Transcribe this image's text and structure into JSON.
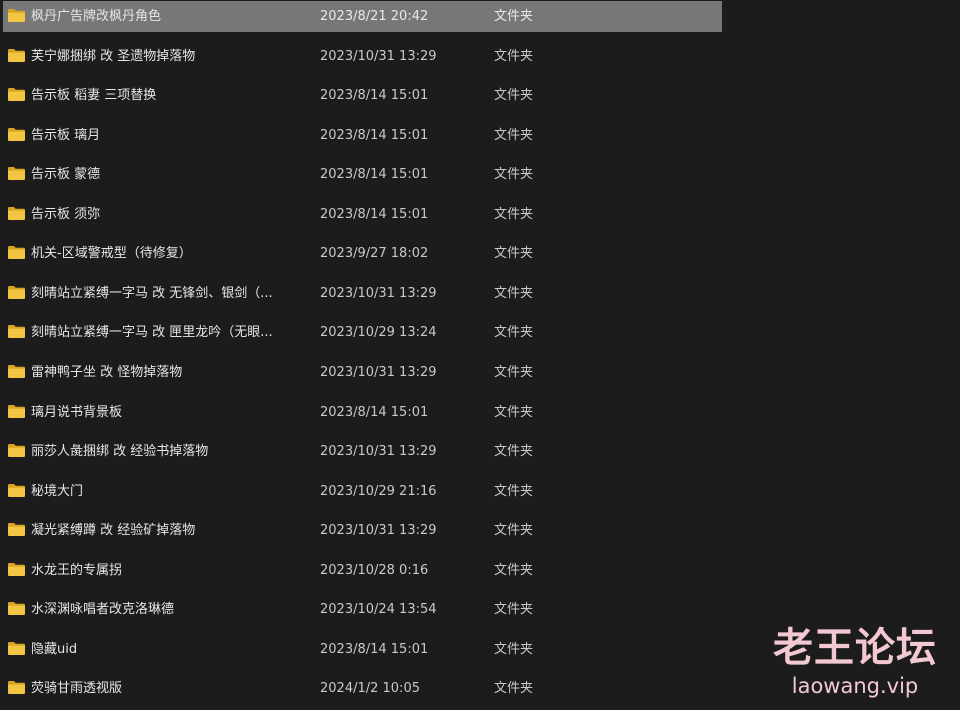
{
  "file_list": {
    "rows": [
      {
        "name": "枫丹广告牌改枫丹角色",
        "date": "2023/8/21 20:42",
        "type": "文件夹",
        "selected": true
      },
      {
        "name": "芙宁娜捆绑 改 圣遗物掉落物",
        "date": "2023/10/31 13:29",
        "type": "文件夹"
      },
      {
        "name": "告示板 稻妻 三项替换",
        "date": "2023/8/14 15:01",
        "type": "文件夹"
      },
      {
        "name": "告示板 璃月",
        "date": "2023/8/14 15:01",
        "type": "文件夹"
      },
      {
        "name": "告示板 蒙德",
        "date": "2023/8/14 15:01",
        "type": "文件夹"
      },
      {
        "name": "告示板 须弥",
        "date": "2023/8/14 15:01",
        "type": "文件夹"
      },
      {
        "name": "机关-区域警戒型（待修复）",
        "date": "2023/9/27 18:02",
        "type": "文件夹"
      },
      {
        "name": "刻晴站立紧缚一字马 改 无锋剑、银剑（...",
        "date": "2023/10/31 13:29",
        "type": "文件夹"
      },
      {
        "name": "刻晴站立紧缚一字马 改 匣里龙吟（无眼...",
        "date": "2023/10/29 13:24",
        "type": "文件夹"
      },
      {
        "name": "雷神鸭子坐 改 怪物掉落物",
        "date": "2023/10/31 13:29",
        "type": "文件夹"
      },
      {
        "name": "璃月说书背景板",
        "date": "2023/8/14 15:01",
        "type": "文件夹"
      },
      {
        "name": "丽莎人彘捆绑 改 经验书掉落物",
        "date": "2023/10/31 13:29",
        "type": "文件夹"
      },
      {
        "name": "秘境大门",
        "date": "2023/10/29 21:16",
        "type": "文件夹"
      },
      {
        "name": "凝光紧缚蹲 改 经验矿掉落物",
        "date": "2023/10/31 13:29",
        "type": "文件夹"
      },
      {
        "name": "水龙王的专属拐",
        "date": "2023/10/28 0:16",
        "type": "文件夹"
      },
      {
        "name": "水深渊咏唱者改克洛琳德",
        "date": "2023/10/24 13:54",
        "type": "文件夹"
      },
      {
        "name": "隐藏uid",
        "date": "2023/8/14 15:01",
        "type": "文件夹"
      },
      {
        "name": "荧骑甘雨透视版",
        "date": "2024/1/2 10:05",
        "type": "文件夹"
      }
    ]
  },
  "watermark": {
    "cn": "老王论坛",
    "en": "laowang.vip"
  },
  "colors": {
    "folder": "#f4c542",
    "folder_dark": "#d9a520",
    "selection": "#777777"
  },
  "icons": {
    "folder": "folder-icon"
  }
}
